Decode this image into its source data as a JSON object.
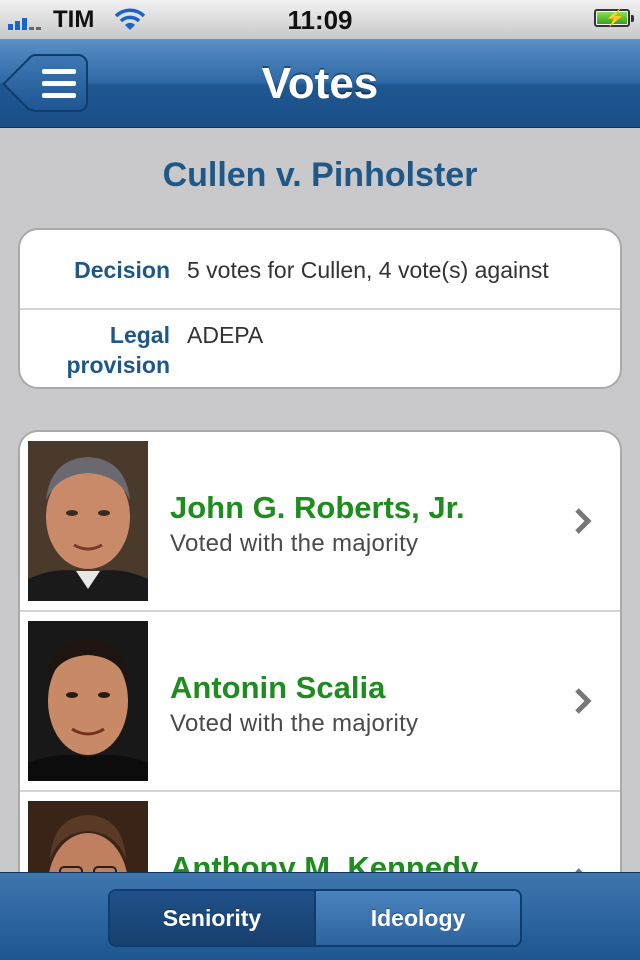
{
  "status": {
    "carrier": "TIM",
    "time": "11:09"
  },
  "nav": {
    "title": "Votes",
    "menu_icon": "menu-icon"
  },
  "case": {
    "title": "Cullen v. Pinholster",
    "decision_label": "Decision",
    "decision_value": "5 votes for Cullen, 4 vote(s) against",
    "provision_label_1": "Legal",
    "provision_label_2": "provision",
    "provision_value": "ADEPA"
  },
  "justices": [
    {
      "name": "John G. Roberts, Jr.",
      "vote": "Voted with the majority"
    },
    {
      "name": "Antonin Scalia",
      "vote": "Voted with the majority"
    },
    {
      "name": "Anthony M. Kennedy",
      "vote": ""
    }
  ],
  "tabs": {
    "seniority": "Seniority",
    "ideology": "Ideology",
    "selected": "Seniority"
  },
  "colors": {
    "nav_blue": "#2f6aa6",
    "title_blue": "#1f5887",
    "name_green": "#1f8c1f"
  }
}
